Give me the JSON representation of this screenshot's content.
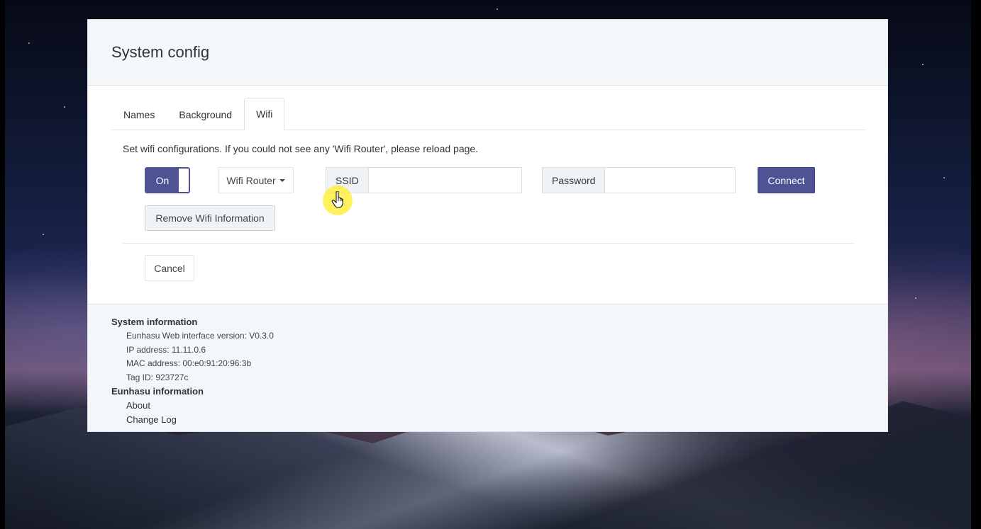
{
  "header": {
    "title": "System config"
  },
  "tabs": [
    {
      "label": "Names",
      "active": false
    },
    {
      "label": "Background",
      "active": false
    },
    {
      "label": "Wifi",
      "active": true
    }
  ],
  "wifi": {
    "description": "Set wifi configurations. If you could not see any 'Wifi Router', please reload page.",
    "toggle_label": "On",
    "toggle_state": "on",
    "router_dropdown_label": "Wifi Router",
    "ssid_label": "SSID",
    "ssid_value": "",
    "password_label": "Password",
    "password_value": "",
    "connect_label": "Connect",
    "remove_label": "Remove Wifi Information",
    "cancel_label": "Cancel"
  },
  "footer": {
    "system_heading": "System information",
    "web_version": "Eunhasu Web interface version: V0.3.0",
    "ip_address": "IP address: 11.11.0.6",
    "mac_address": "MAC address: 00:e0:91:20:96:3b",
    "tag_id": "Tag ID: 923727c",
    "eunhasu_heading": "Eunhasu information",
    "about_label": "About",
    "changelog_label": "Change Log"
  },
  "colors": {
    "accent": "#4f5293",
    "cursor_highlight": "#ffee28"
  },
  "icons": {
    "cursor": "hand-pointer-icon"
  }
}
